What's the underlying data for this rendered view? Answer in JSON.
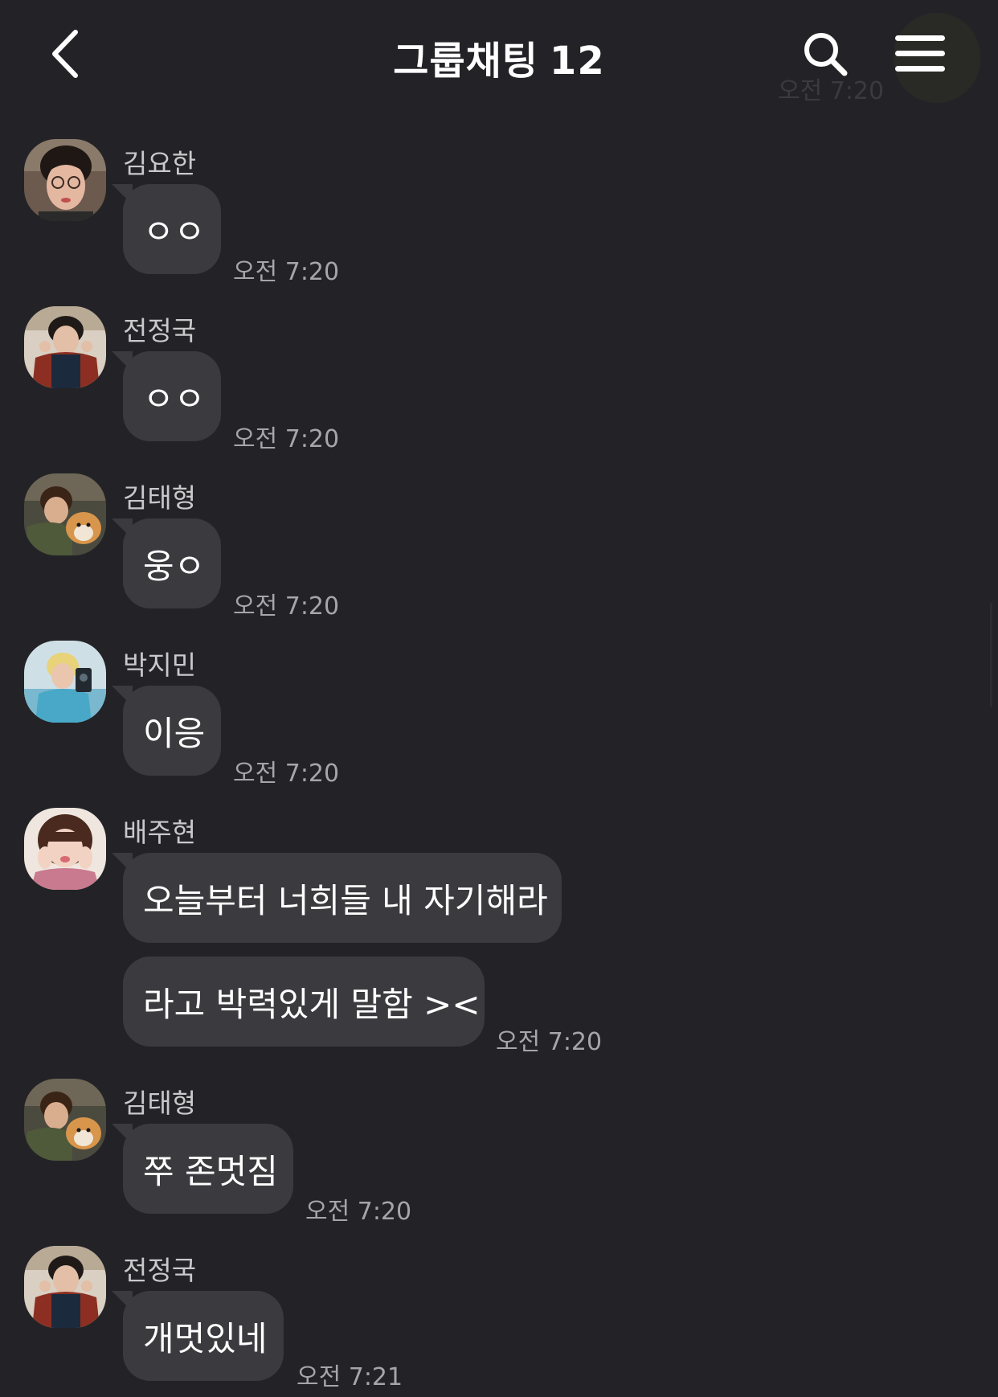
{
  "header": {
    "title": "그룹채팅",
    "member_count": "12",
    "ghost_time": "오전 7:20"
  },
  "messages": [
    {
      "sender": "김요한",
      "bubbles": [
        "ㅇㅇ"
      ],
      "time": "오전 7:20",
      "avatar": "avatar-kim-yohan"
    },
    {
      "sender": "전정국",
      "bubbles": [
        "ㅇㅇ"
      ],
      "time": "오전 7:20",
      "avatar": "avatar-jeon-jungkook"
    },
    {
      "sender": "김태형",
      "bubbles": [
        "웅ㅇ"
      ],
      "time": "오전 7:20",
      "avatar": "avatar-kim-taehyung"
    },
    {
      "sender": "박지민",
      "bubbles": [
        "이응"
      ],
      "time": "오전 7:20",
      "avatar": "avatar-park-jimin"
    },
    {
      "sender": "배주현",
      "bubbles": [
        "오늘부터 너희들 내 자기해라",
        "라고 박력있게 말함 ><"
      ],
      "time": "오전 7:20",
      "avatar": "avatar-bae-joohyun"
    },
    {
      "sender": "김태형",
      "bubbles": [
        "쭈 존멋짐"
      ],
      "time": "오전 7:20",
      "avatar": "avatar-kim-taehyung"
    },
    {
      "sender": "전정국",
      "bubbles": [
        "개멋있네"
      ],
      "time": "오전 7:21",
      "avatar": "avatar-jeon-jungkook"
    }
  ],
  "colors": {
    "background": "#232327",
    "bubble": "#3b3b3f",
    "text": "#ffffff",
    "sender": "#c9c9cc",
    "time": "#a6a6aa"
  },
  "icons": [
    "chevron-left-icon",
    "search-icon",
    "menu-icon"
  ]
}
